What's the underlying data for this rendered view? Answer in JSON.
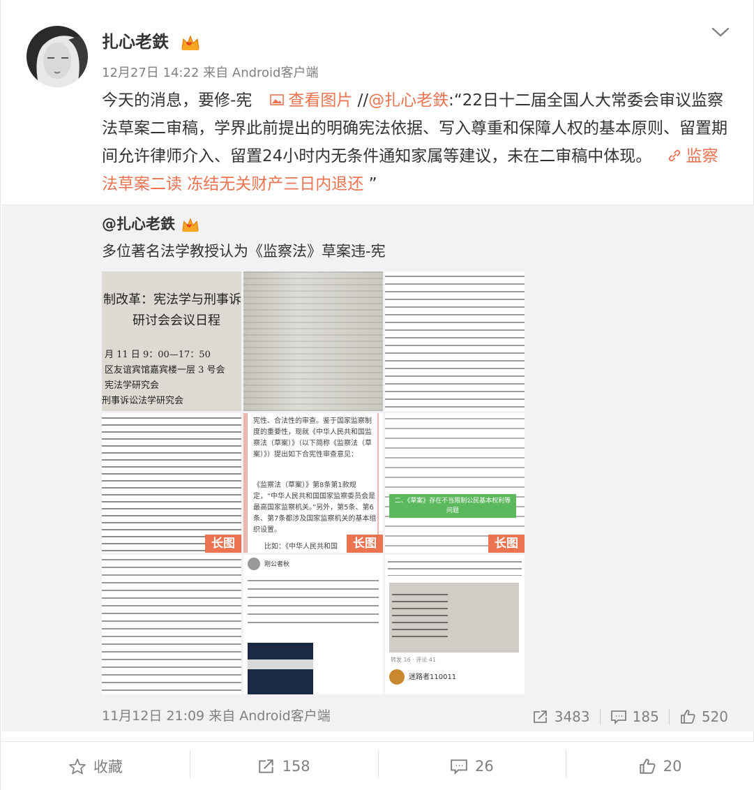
{
  "post": {
    "author": "扎心老鉄",
    "time": "12月27日 14:22",
    "source_prefix": "来自",
    "source": "Android客户端",
    "text_lead": "今天的消息，要修-宪",
    "view_image_label": "查看图片",
    "repost_sep": "//",
    "mention": "@扎心老鉄",
    "text_body": ":“22日十二届全国人大常委会审议监察法草案二审稿，学界此前提出的明确宪法依据、写入尊重和保障人权的基本原则、留置期间允许律师介入、留置24小时内无条件通知家属等建议，未在二审稿中体现。",
    "link_label": "监察法草案二读 冻结无关财产三日内退还",
    "text_tail": " ”"
  },
  "quoted": {
    "author": "@扎心老鉄",
    "text": "多位著名法学教授认为《监察法》草案违-宪",
    "images": [
      {
        "lines": [
          "制改革：宪法学与刑事诉",
          "研讨会会议日程",
          "月 11 日 9：00—17：50",
          "区友谊宾馆嘉宾楼一层 3 号会",
          "宪法学研究会",
          "刑事诉讼法学研究会"
        ]
      },
      {
        "lines": []
      },
      {
        "lines": []
      },
      {
        "lines": [],
        "long": "长图"
      },
      {
        "lines": [],
        "long": "长图"
      },
      {
        "lines": [],
        "long": "长图"
      },
      {
        "lines": []
      },
      {
        "lines": []
      },
      {
        "lines": []
      }
    ],
    "thumb_text": {
      "t5_head": "宪性、合法性的审查。鉴于国家监察制度的重要性，现就《中华人民共和国监察法（草案）》（以下简称《监察法（草案）》）提出如下合宪性审查意见：",
      "t5_body": "《监察法（草案）》第8条第1款规定，“中华人民共和国国家监察委员会是最高国家监察机关。”另外，第5条、第6条、第7条都涉及国家监察机关的基本组织设置。",
      "t5_foot": "比如：《中华人民共和国",
      "t6_green": "二、《草案》存在不当限制公民基本权利等问题",
      "t8_user": "刚公者秋",
      "t9_user": "迷路者110011",
      "t9_tabs": "转发 16 · 评论 41"
    },
    "time": "11月12日 21:09",
    "source_prefix": "来自",
    "source": "Android客户端",
    "reposts": "3483",
    "comments": "185",
    "likes": "520"
  },
  "actions": {
    "favorite": "收藏",
    "repost": "158",
    "comment": "26",
    "like": "20"
  },
  "colors": {
    "link": "#eb7350",
    "muted": "#808080",
    "quote_bg": "#f2f2f5"
  }
}
